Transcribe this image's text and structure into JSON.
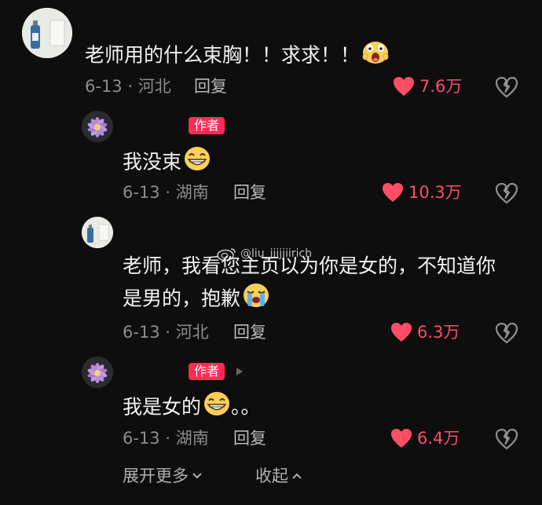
{
  "comments": [
    {
      "text": "老师用的什么束胸！！求求！！",
      "date": "6-13",
      "location": "河北",
      "reply_label": "回复",
      "likes": "7.6万",
      "avatar_icon": "product-photo-avatar",
      "emoji": "screaming-face"
    },
    {
      "badge": "作者",
      "text": "我没束",
      "date": "6-13",
      "location": "湖南",
      "reply_label": "回复",
      "likes": "10.3万",
      "avatar_icon": "lotus-flower-avatar",
      "emoji": "grinning-face"
    },
    {
      "text_line1": "老师，我看您主页以为你是女的，不知道你",
      "text_line2": "是男的，抱歉",
      "date": "6-13",
      "location": "河北",
      "reply_label": "回复",
      "likes": "6.3万",
      "avatar_icon": "product-photo-avatar",
      "emoji": "crying-face"
    },
    {
      "badge": "作者",
      "text": "我是女的",
      "text_suffix": "。。",
      "date": "6-13",
      "location": "湖南",
      "reply_label": "回复",
      "likes": "6.4万",
      "avatar_icon": "lotus-flower-avatar",
      "emoji": "grinning-face"
    }
  ],
  "watermark": "@liu_iiijjiirich",
  "footer": {
    "expand_more": "展开更多",
    "collapse": "收起"
  },
  "colors": {
    "background": "#0e0e0e",
    "like_red": "#ff4d66",
    "badge_pink": "#fd2c55"
  }
}
